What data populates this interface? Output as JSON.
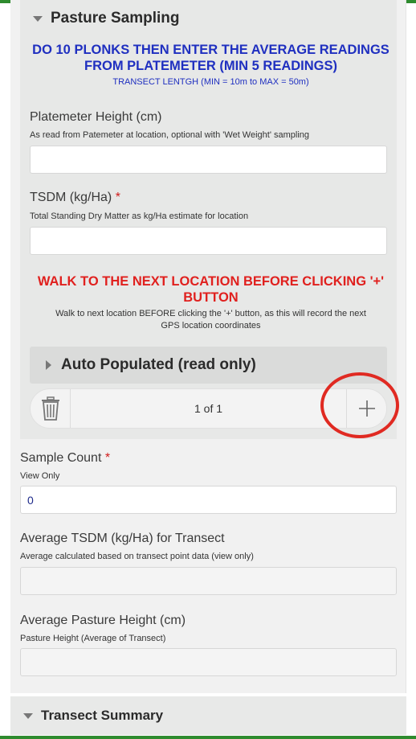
{
  "pasture_sampling": {
    "title": "Pasture Sampling",
    "instruction_line1": "DO 10 PLONKS THEN ENTER THE AVERAGE READINGS",
    "instruction_line2": "FROM PLATEMETER (MIN 5 READINGS)",
    "instruction_small": "TRANSECT LENTGH (MIN = 10m to MAX = 50m)",
    "platemeter": {
      "label": "Platemeter Height (cm)",
      "hint": "As read from Patemeter at location, optional with 'Wet Weight' sampling",
      "value": ""
    },
    "tsdm": {
      "label": "TSDM (kg/Ha)",
      "required_mark": "*",
      "hint": "Total Standing Dry Matter as kg/Ha estimate for location",
      "value": ""
    },
    "walk_line1": "WALK TO THE NEXT LOCATION BEFORE CLICKING '+'",
    "walk_line2": "BUTTON",
    "walk_note_line1": "Walk to next location BEFORE clicking the '+' button, as this will record the next",
    "walk_note_line2": "GPS location coordinates",
    "auto_populated": "Auto Populated (read only)",
    "pager": {
      "count": "1 of 1",
      "delete_icon": "trash-icon",
      "add_icon": "plus-icon"
    }
  },
  "sample_count": {
    "label": "Sample Count",
    "required_mark": "*",
    "hint": "View Only",
    "value": "0"
  },
  "avg_tsdm": {
    "label": "Average TSDM (kg/Ha) for Transect",
    "hint": "Average calculated based on transect point data (view only)",
    "value": ""
  },
  "avg_height": {
    "label": "Average Pasture Height (cm)",
    "hint": "Pasture Height (Average of Transect)",
    "value": ""
  },
  "transect_summary": {
    "title": "Transect Summary"
  },
  "colors": {
    "accent_green": "#2e8b2e",
    "instruction_blue": "#1f2fc0",
    "warning_red": "#e0201e",
    "annotation_red": "#e02a22"
  }
}
